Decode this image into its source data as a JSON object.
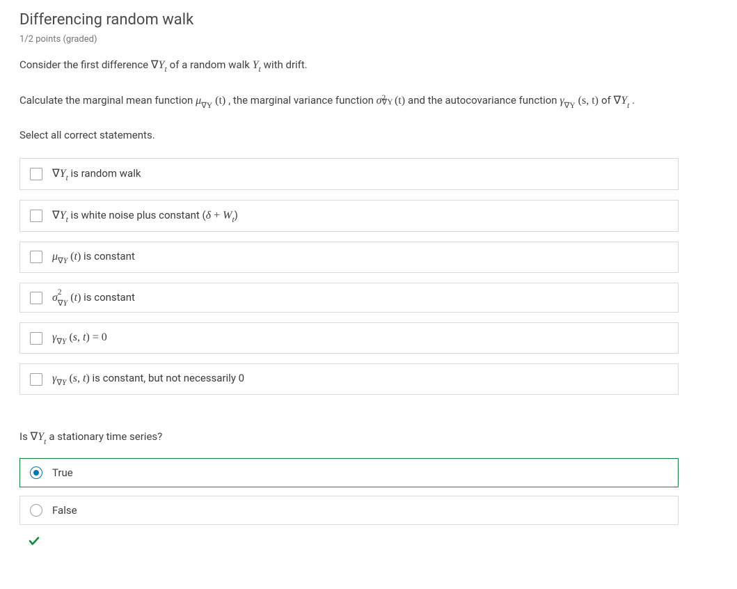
{
  "title": "Differencing random walk",
  "points": "1/2 points (graded)",
  "paragraph1": {
    "pre": "Consider the first difference ",
    "m1": {
      "nabla": "∇",
      "Y": "Y",
      "sub": "t"
    },
    "mid": " of a random walk ",
    "m2": {
      "Y": "Y",
      "sub": "t"
    },
    "post": " with drift."
  },
  "paragraph2": {
    "pre": "Calculate the marginal mean function ",
    "mu": {
      "mu": "μ",
      "sub": "∇Y",
      "arg": "(t)"
    },
    "mid1": ", the marginal variance function ",
    "sigma": {
      "sigma": "σ",
      "sup": "2",
      "sub": "∇Y",
      "arg": "(t)"
    },
    "mid2": " and the autocovariance function ",
    "gamma": {
      "gamma": "γ",
      "sub": "∇Y",
      "arg": "(s, t)"
    },
    "mid3": " of ",
    "nabY": {
      "nabla": "∇",
      "Y": "Y",
      "sub": "t"
    },
    "post": "."
  },
  "instruction": "Select all correct statements.",
  "checkbox_options": [
    {
      "pre": "",
      "math": "∇Y_t",
      "post": " is random walk"
    },
    {
      "pre": "",
      "math": "∇Y_t",
      "post": " is white noise plus constant (δ + W_t)"
    },
    {
      "pre": "",
      "math": "μ_∇Y (t)",
      "post": " is constant"
    },
    {
      "pre": "",
      "math": "σ^2_∇Y (t)",
      "post": " is constant"
    },
    {
      "pre": "",
      "math": "γ_∇Y (s, t) = 0",
      "post": ""
    },
    {
      "pre": "",
      "math": "γ_∇Y (s, t)",
      "post": " is constant, but not necessarily 0"
    }
  ],
  "question2": {
    "pre": "Is ",
    "math": {
      "nabla": "∇",
      "Y": "Y",
      "sub": "t"
    },
    "post": " a stationary time series?"
  },
  "radio_options": [
    {
      "label": "True",
      "selected": true,
      "correct": true
    },
    {
      "label": "False",
      "selected": false,
      "correct": false
    }
  ],
  "correct_mark": "✔"
}
